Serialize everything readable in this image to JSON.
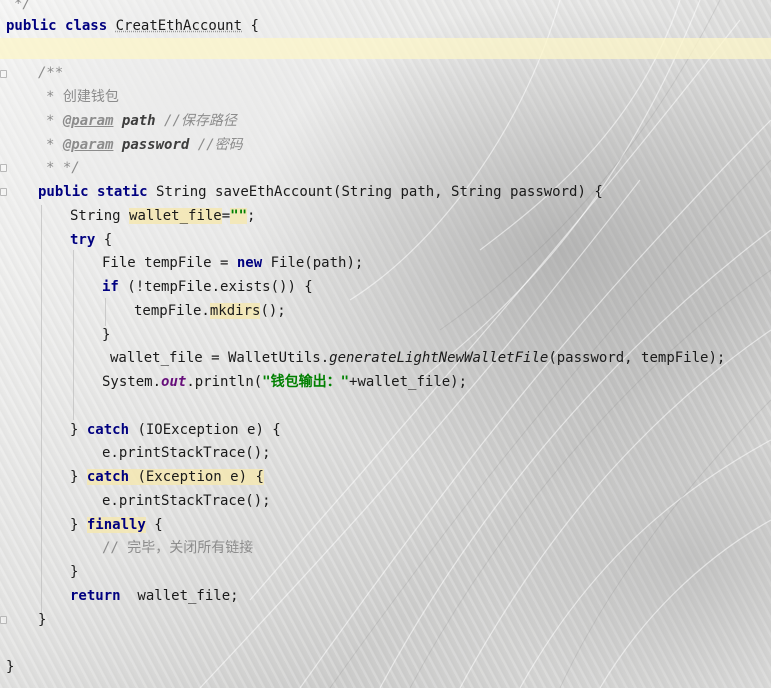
{
  "editor": {
    "lines": {
      "l0": "*/",
      "l1_kw1": "public",
      "l1_kw2": "class",
      "l1_name": "CreatEthAccount",
      "l1_brace": "{",
      "l3": "/**",
      "l4_star": "*",
      "l4_text": "创建钱包",
      "l5_star": "*",
      "l5_tag": "@param",
      "l5_name": "path",
      "l5_comment": "//保存路径",
      "l6_star": "*",
      "l6_tag": "@param",
      "l6_name": "password",
      "l6_comment": "//密码",
      "l7": "* */",
      "l8_kw1": "public",
      "l8_kw2": "static",
      "l8_rest": "String saveEthAccount(String path, String password) {",
      "l9_type": "String",
      "l9_var": "wallet_file",
      "l9_eq": "=",
      "l9_str": "\"\"",
      "l9_end": ";",
      "l10_kw": "try",
      "l10_brace": "{",
      "l11_a": "File tempFile = ",
      "l11_kw": "new",
      "l11_b": " File(path);",
      "l12_kw": "if",
      "l12_rest": "(!tempFile.exists()) {",
      "l13_a": "tempFile.",
      "l13_m": "mkdirs",
      "l13_b": "();",
      "l14": "}",
      "l15_a": "wallet_file = WalletUtils.",
      "l15_m": "generateLightNewWalletFile",
      "l15_b": "(password, tempFile);",
      "l16_a": "System.",
      "l16_f": "out",
      "l16_b": ".println(",
      "l16_str": "\"钱包输出：\"",
      "l16_c": "+wallet_file);",
      "l18_a": "} ",
      "l18_kw": "catch",
      "l18_b": " (IOException e) {",
      "l19": "e.printStackTrace();",
      "l20_a": "} ",
      "l20_kw": "catch",
      "l20_b": " (Exception e) {",
      "l21": "e.printStackTrace();",
      "l22_a": "} ",
      "l22_kw": "finally",
      "l22_b": " {",
      "l23": "// 完毕，关闭所有链接",
      "l24": "}",
      "l25_kw": "return",
      "l25_b": "  wallet_file;",
      "l26": "}",
      "l28": "}"
    }
  }
}
